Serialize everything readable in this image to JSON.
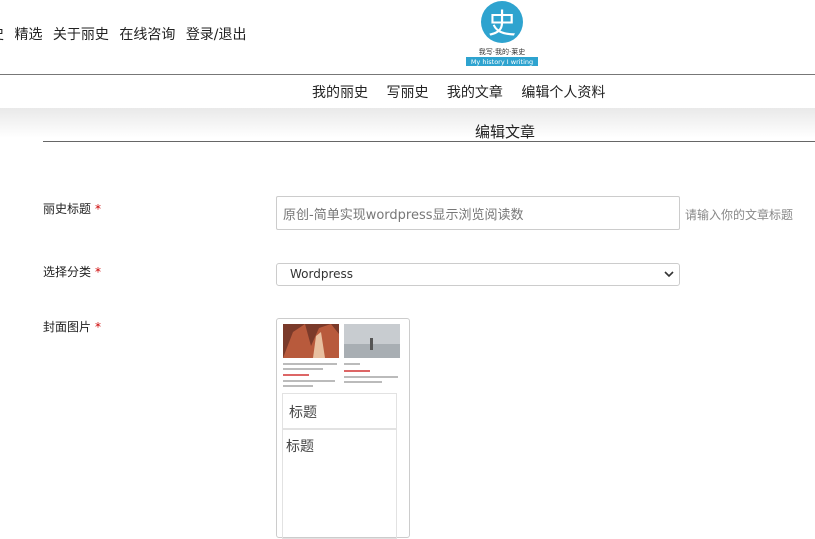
{
  "topnav": {
    "items": [
      "史",
      "精选",
      "关于丽史",
      "在线咨询",
      "登录/退出"
    ]
  },
  "logo": {
    "glyph": "史",
    "motto": "我写·我的·莱史",
    "subtitle": "My history  I writing"
  },
  "subnav": {
    "items": [
      "我的丽史",
      "写丽史",
      "我的文章",
      "编辑个人资料"
    ]
  },
  "page": {
    "title": "编辑文章"
  },
  "form": {
    "required_mark": "*",
    "title_label": "丽史标题",
    "title_value": "原创-简单实现wordpress显示浏览阅读数",
    "title_hint": "请输入你的文章标题",
    "category_label": "选择分类",
    "category_value": "Wordpress",
    "cover_label": "封面图片",
    "cover_box1": "标题",
    "cover_box2": "标题"
  },
  "colors": {
    "accent": "#2ea3cf",
    "required": "#cc0000"
  }
}
